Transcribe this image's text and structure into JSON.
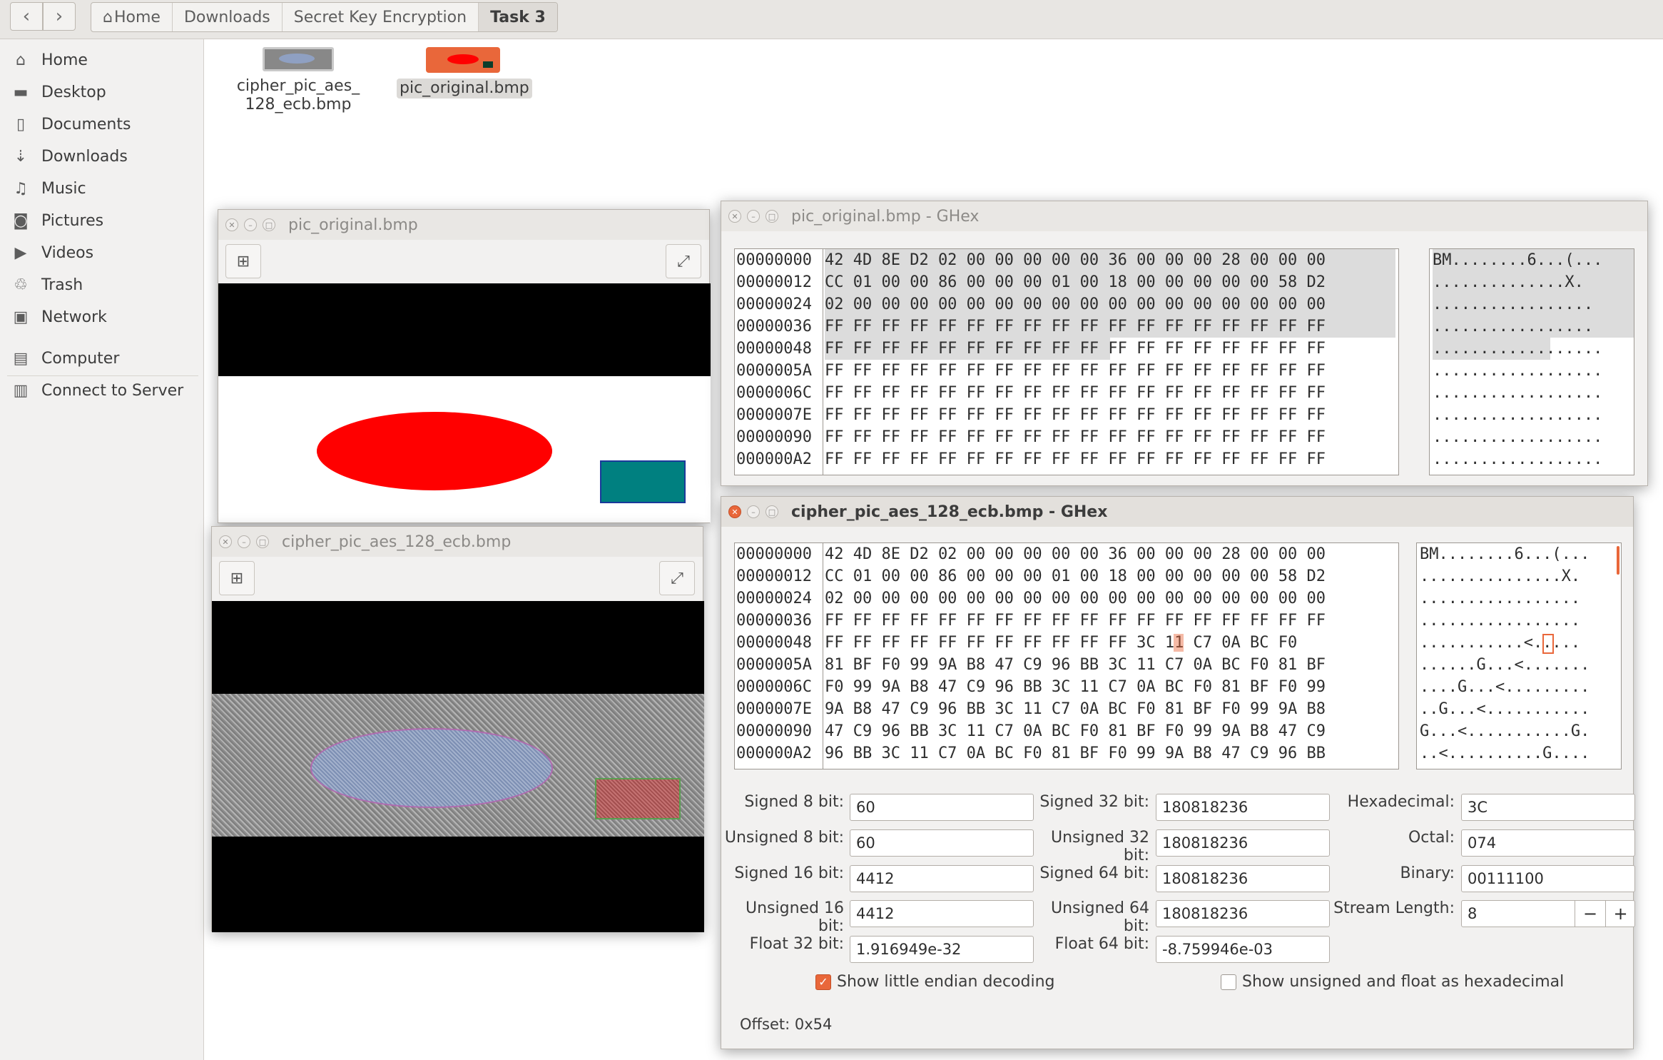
{
  "path_bar": {
    "crumbs": [
      "Home",
      "Downloads",
      "Secret Key Encryption",
      "Task 3"
    ]
  },
  "sidebar": {
    "items": [
      {
        "label": "Home",
        "icon": "home-icon"
      },
      {
        "label": "Desktop",
        "icon": "folder-icon"
      },
      {
        "label": "Documents",
        "icon": "document-icon"
      },
      {
        "label": "Downloads",
        "icon": "download-icon"
      },
      {
        "label": "Music",
        "icon": "music-icon"
      },
      {
        "label": "Pictures",
        "icon": "camera-icon"
      },
      {
        "label": "Videos",
        "icon": "video-icon"
      },
      {
        "label": "Trash",
        "icon": "trash-icon"
      },
      {
        "label": "Network",
        "icon": "network-icon"
      },
      {
        "label": "Computer",
        "icon": "computer-icon"
      },
      {
        "label": "Connect to Server",
        "icon": "server-icon"
      }
    ]
  },
  "files": [
    {
      "name_line1": "cipher_pic_aes_",
      "name_line2": "128_ecb.bmp"
    },
    {
      "name_line1": "pic_original.bmp",
      "name_line2": ""
    }
  ],
  "viewer_original": {
    "title": "pic_original.bmp"
  },
  "viewer_cipher": {
    "title": "cipher_pic_aes_128_ecb.bmp"
  },
  "ghex_original": {
    "title": "pic_original.bmp - GHex",
    "offsets": [
      "00000000",
      "00000012",
      "00000024",
      "00000036",
      "00000048",
      "0000005A",
      "0000006C",
      "0000007E",
      "00000090",
      "000000A2"
    ],
    "hex": [
      "42 4D 8E D2 02 00 00 00 00 00 36 00 00 00 28 00 00 00",
      "CC 01 00 00 86 00 00 00 01 00 18 00 00 00 00 00 58 D2",
      "02 00 00 00 00 00 00 00 00 00 00 00 00 00 00 00 00 00",
      "FF FF FF FF FF FF FF FF FF FF FF FF FF FF FF FF FF FF",
      "FF FF FF FF FF FF FF FF FF FF FF FF FF FF FF FF FF FF",
      "FF FF FF FF FF FF FF FF FF FF FF FF FF FF FF FF FF FF",
      "FF FF FF FF FF FF FF FF FF FF FF FF FF FF FF FF FF FF",
      "FF FF FF FF FF FF FF FF FF FF FF FF FF FF FF FF FF FF",
      "FF FF FF FF FF FF FF FF FF FF FF FF FF FF FF FF FF FF",
      "FF FF FF FF FF FF FF FF FF FF FF FF FF FF FF FF FF FF"
    ],
    "ascii": [
      "BM........6...(...",
      "..............X.",
      ".................",
      ".................",
      "..................",
      "..................",
      "..................",
      "..................",
      "..................",
      ".................."
    ]
  },
  "ghex_cipher": {
    "title": "cipher_pic_aes_128_ecb.bmp - GHex",
    "offsets": [
      "00000000",
      "00000012",
      "00000024",
      "00000036",
      "00000048",
      "0000005A",
      "0000006C",
      "0000007E",
      "00000090",
      "000000A2"
    ],
    "hex": [
      "42 4D 8E D2 02 00 00 00 00 00 36 00 00 00 28 00 00 00",
      "CC 01 00 00 86 00 00 00 01 00 18 00 00 00 00 00 58 D2",
      "02 00 00 00 00 00 00 00 00 00 00 00 00 00 00 00 00 00",
      "FF FF FF FF FF FF FF FF FF FF FF FF FF FF FF FF FF FF",
      "FF FF FF FF FF FF FF FF FF FF FF 3C 11 C7 0A BC F0",
      "81 BF F0 99 9A B8 47 C9 96 BB 3C 11 C7 0A BC F0 81 BF",
      "F0 99 9A B8 47 C9 96 BB 3C 11 C7 0A BC F0 81 BF F0 99",
      "9A B8 47 C9 96 BB 3C 11 C7 0A BC F0 81 BF F0 99 9A B8",
      "47 C9 96 BB 3C 11 C7 0A BC F0 81 BF F0 99 9A B8 47 C9",
      "96 BB 3C 11 C7 0A BC F0 81 BF F0 99 9A B8 47 C9 96 BB"
    ],
    "ascii": [
      "BM........6...(...",
      "...............X.",
      ".................",
      ".................",
      "...........<.....",
      "......G...<.......",
      "....G...<.........",
      "..G...<...........",
      "G...<...........G.",
      "..<..........G...."
    ]
  },
  "decoder": {
    "fields": [
      {
        "label": "Signed 8 bit:",
        "value": "60"
      },
      {
        "label": "Unsigned 8 bit:",
        "value": "60"
      },
      {
        "label": "Signed 16 bit:",
        "value": "4412"
      },
      {
        "label": "Unsigned 16 bit:",
        "value": "4412"
      },
      {
        "label": "Float 32 bit:",
        "value": "1.916949e-32"
      },
      {
        "label": "Signed 32 bit:",
        "value": "180818236"
      },
      {
        "label": "Unsigned 32 bit:",
        "value": "180818236"
      },
      {
        "label": "Signed 64 bit:",
        "value": "180818236"
      },
      {
        "label": "Unsigned 64 bit:",
        "value": "180818236"
      },
      {
        "label": "Float 64 bit:",
        "value": "-8.759946e-03"
      },
      {
        "label": "Hexadecimal:",
        "value": "3C"
      },
      {
        "label": "Octal:",
        "value": "074"
      },
      {
        "label": "Binary:",
        "value": "00111100"
      },
      {
        "label": "Stream Length:",
        "value": "8"
      }
    ],
    "little_endian_label": "Show little endian decoding",
    "little_endian_checked": true,
    "unsigned_hex_label": "Show unsigned and float as hexadecimal",
    "unsigned_hex_checked": false,
    "offset_text": "Offset: 0x54"
  },
  "colors": {
    "accent": "#e9673a",
    "image_red": "#ff0000",
    "image_teal": "#008080"
  }
}
